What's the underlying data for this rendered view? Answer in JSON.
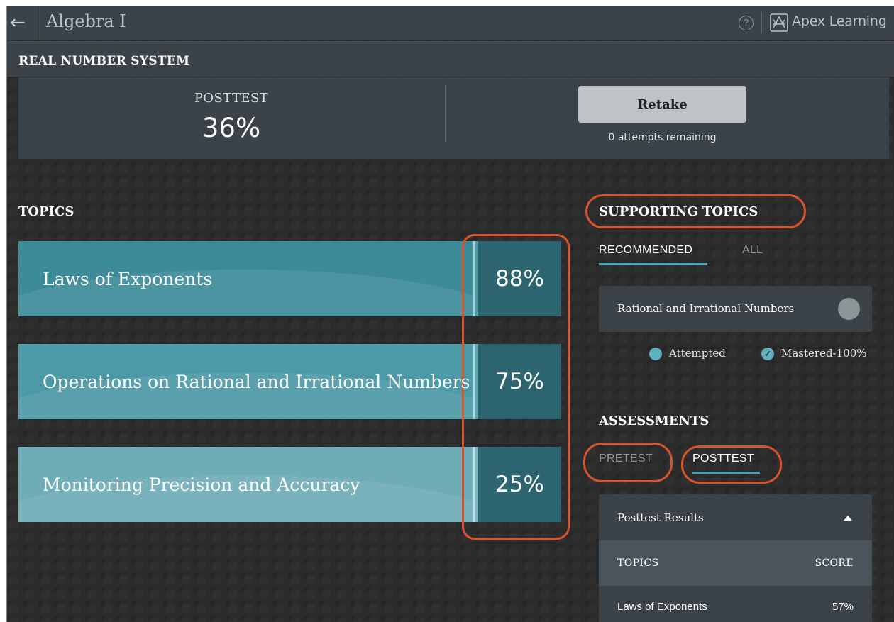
{
  "header": {
    "course_title": "Algebra I",
    "brand_name": "Apex Learning",
    "help_symbol": "?",
    "back_icon": "arrow-left-icon"
  },
  "section": {
    "title": "REAL NUMBER SYSTEM"
  },
  "score_panel": {
    "label": "POSTTEST",
    "score": "36%",
    "retake_label": "Retake",
    "attempts_text": "0 attempts remaining"
  },
  "topics": {
    "heading": "TOPICS",
    "items": [
      {
        "name": "Laws of Exponents",
        "percent": "88%"
      },
      {
        "name": "Operations on Rational and Irrational Numbers",
        "percent": "75%"
      },
      {
        "name": "Monitoring Precision and Accuracy",
        "percent": "25%"
      }
    ]
  },
  "supporting": {
    "heading": "SUPPORTING TOPICS",
    "tabs": [
      {
        "label": "RECOMMENDED",
        "active": true
      },
      {
        "label": "ALL",
        "active": false
      }
    ],
    "items": [
      {
        "label": "Rational and Irrational Numbers",
        "status": "not-started"
      }
    ],
    "legend": {
      "attempted": "Attempted",
      "mastered": "Mastered-100%"
    }
  },
  "assessments": {
    "heading": "ASSESSMENTS",
    "tabs": [
      {
        "label": "PRETEST",
        "active": false
      },
      {
        "label": "POSTTEST",
        "active": true
      }
    ],
    "results": {
      "title": "Posttest Results",
      "col_topics": "TOPICS",
      "col_score": "SCORE",
      "rows": [
        {
          "topic": "Laws of Exponents",
          "score": "57%"
        }
      ]
    }
  },
  "colors": {
    "accent": "#48a5b6",
    "annotation": "#d9542b",
    "panel": "#3b4348",
    "background": "#2b2b2b"
  }
}
